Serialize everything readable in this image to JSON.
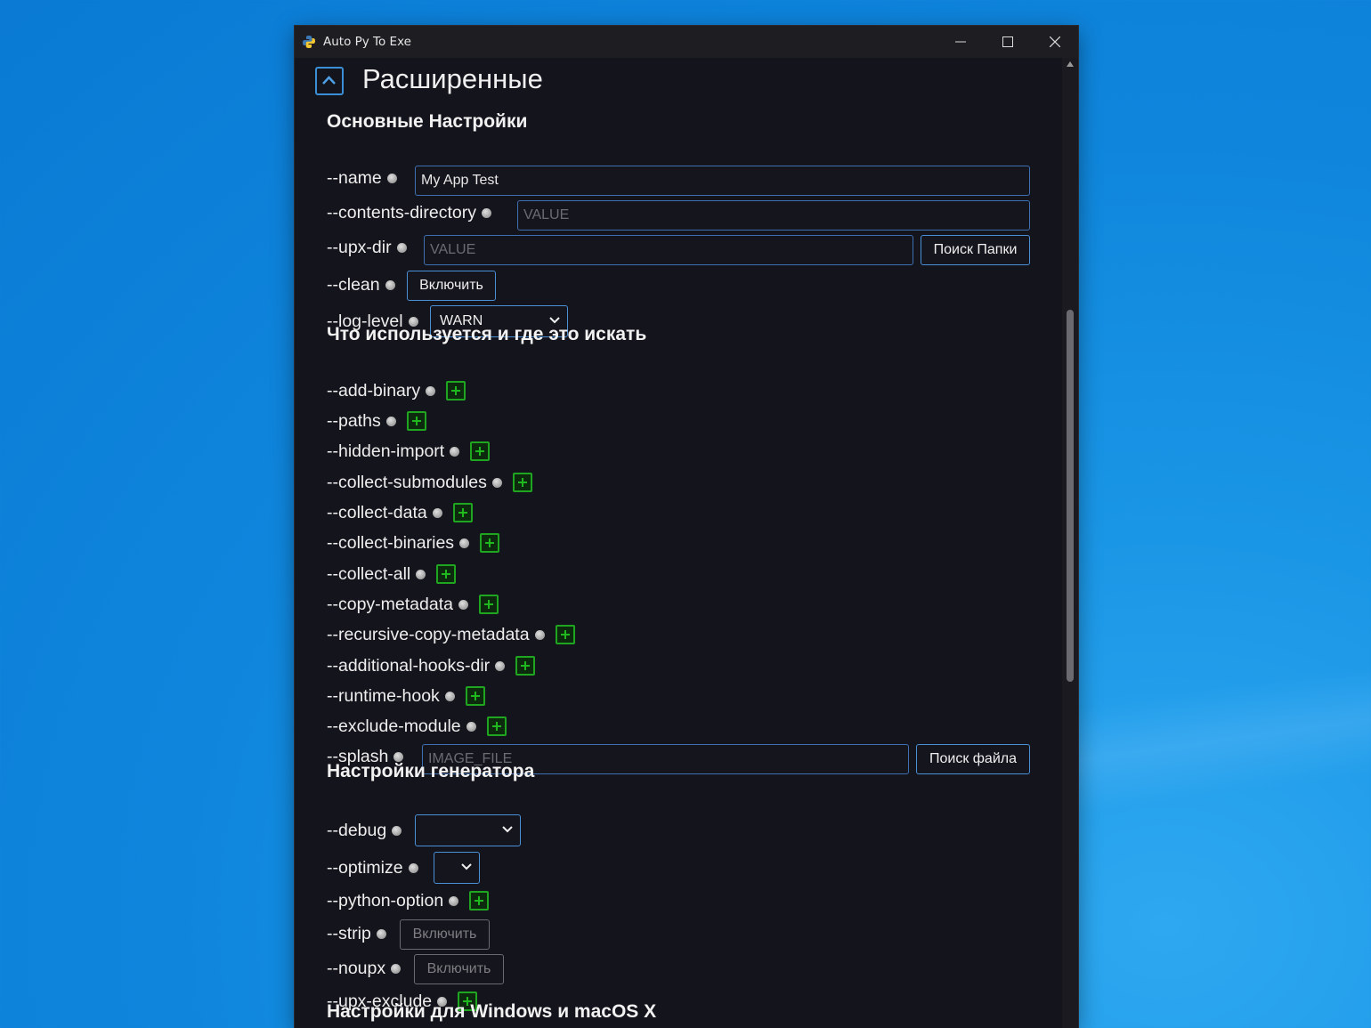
{
  "window": {
    "title": "Auto Py To Exe"
  },
  "section": {
    "title": "Расширенные"
  },
  "groups": {
    "basic": "Основные Настройки",
    "what_to_bundle": "Что используется и где это искать",
    "generator": "Настройки генератора",
    "windows_mac": "Настройки для Windows и macOS X"
  },
  "options": {
    "name": {
      "label": "--name",
      "value": "My App Test"
    },
    "contents_directory": {
      "label": "--contents-directory",
      "placeholder": "VALUE"
    },
    "upx_dir": {
      "label": "--upx-dir",
      "placeholder": "VALUE",
      "button": "Поиск Папки"
    },
    "clean": {
      "label": "--clean",
      "button": "Включить"
    },
    "log_level": {
      "label": "--log-level",
      "selected": "WARN"
    },
    "add_binary": {
      "label": "--add-binary"
    },
    "paths": {
      "label": "--paths"
    },
    "hidden_import": {
      "label": "--hidden-import"
    },
    "collect_submodules": {
      "label": "--collect-submodules"
    },
    "collect_data": {
      "label": "--collect-data"
    },
    "collect_binaries": {
      "label": "--collect-binaries"
    },
    "collect_all": {
      "label": "--collect-all"
    },
    "copy_metadata": {
      "label": "--copy-metadata"
    },
    "recursive_copy_metadata": {
      "label": "--recursive-copy-metadata"
    },
    "additional_hooks_dir": {
      "label": "--additional-hooks-dir"
    },
    "runtime_hook": {
      "label": "--runtime-hook"
    },
    "exclude_module": {
      "label": "--exclude-module"
    },
    "splash": {
      "label": "--splash",
      "placeholder": "IMAGE_FILE",
      "button": "Поиск файла"
    },
    "debug": {
      "label": "--debug",
      "selected": ""
    },
    "optimize": {
      "label": "--optimize",
      "selected": ""
    },
    "python_option": {
      "label": "--python-option"
    },
    "strip": {
      "label": "--strip",
      "button": "Включить"
    },
    "noupx": {
      "label": "--noupx",
      "button": "Включить"
    },
    "upx_exclude": {
      "label": "--upx-exclude"
    }
  },
  "colors": {
    "accent_border": "#4b8fd6",
    "add_green": "#1fa51f",
    "window_bg": "#14141c"
  }
}
